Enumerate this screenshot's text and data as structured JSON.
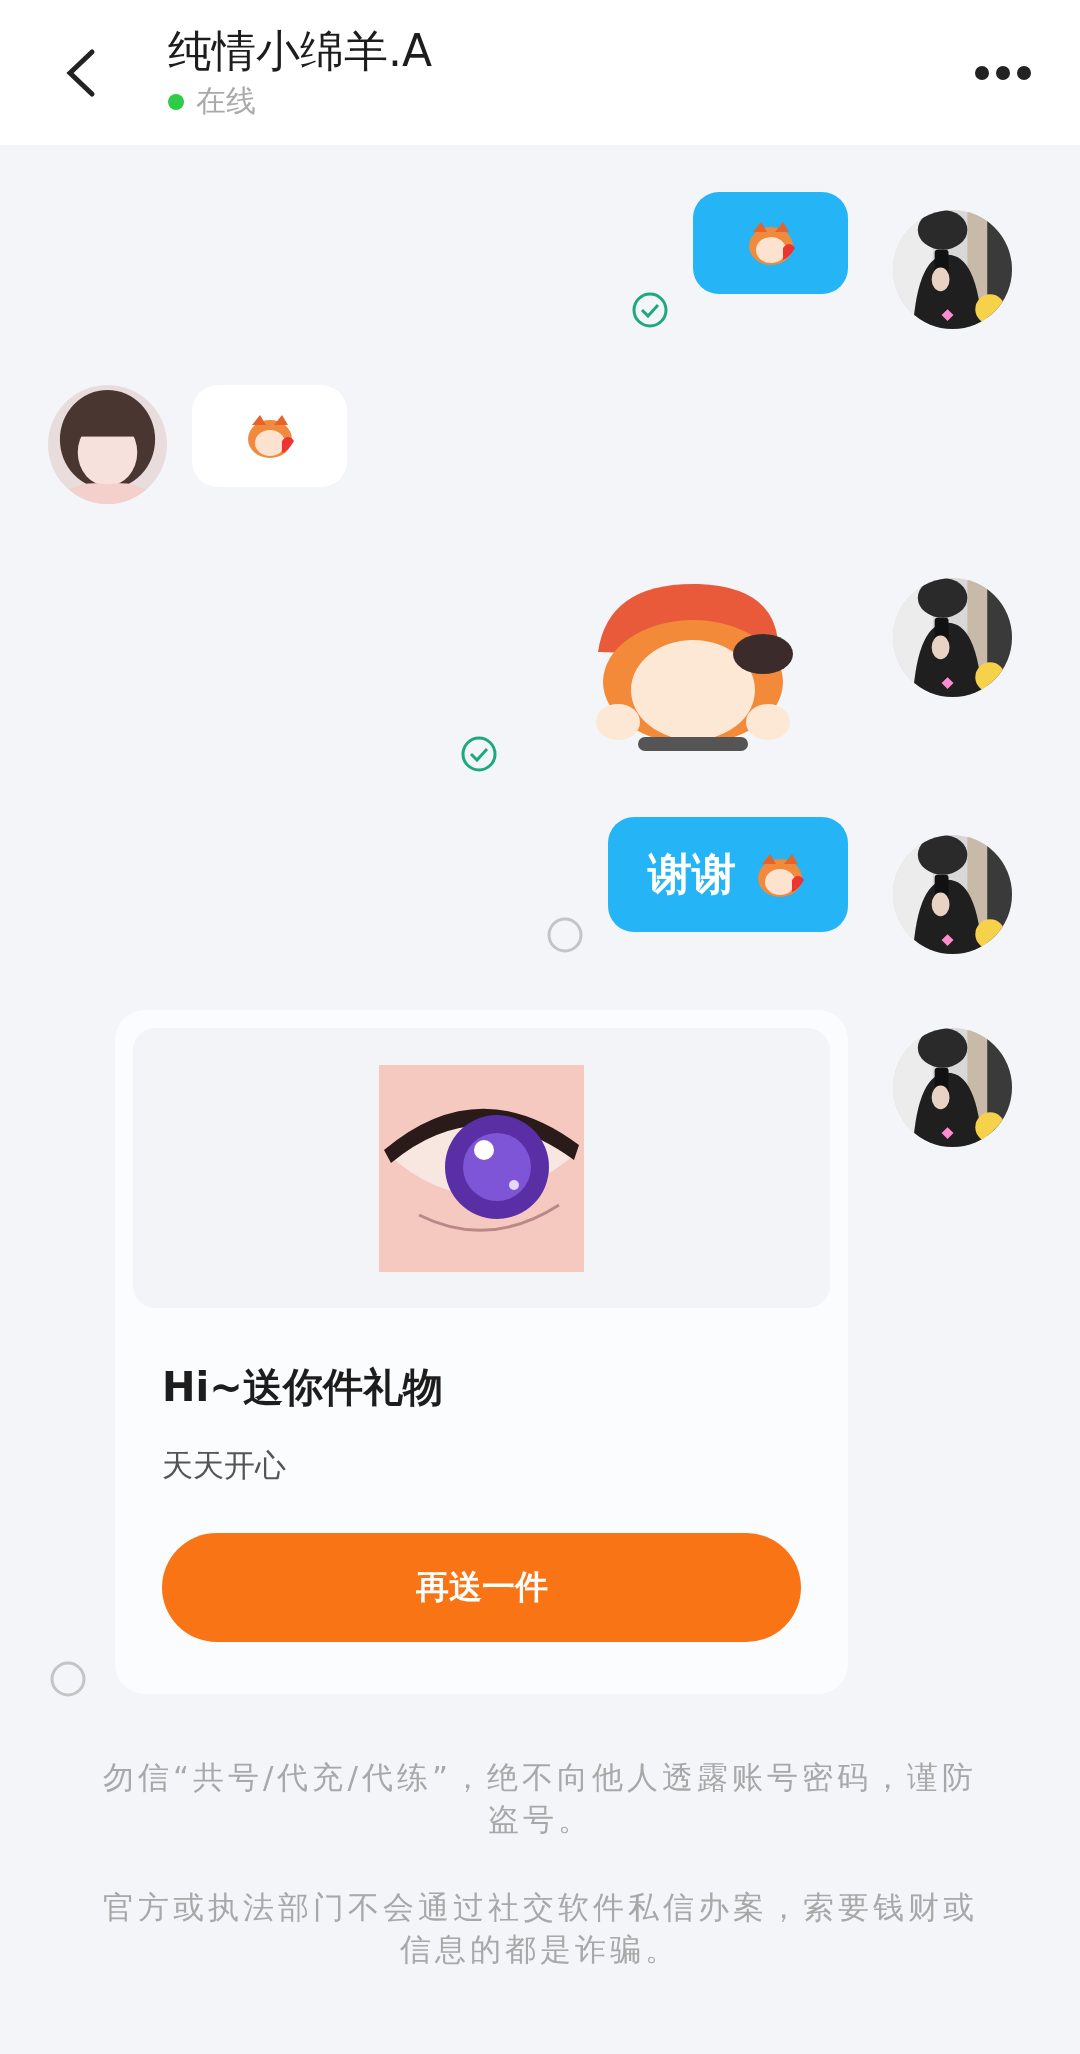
{
  "header": {
    "title": "纯情小绵羊.A",
    "status": "在线",
    "online": true
  },
  "messages": [
    {
      "outgoing": true,
      "kind": "sticker",
      "read": true
    },
    {
      "outgoing": false,
      "kind": "sticker"
    },
    {
      "outgoing": true,
      "kind": "big_sticker",
      "read": true
    },
    {
      "outgoing": true,
      "kind": "text",
      "text": "谢谢",
      "read": false
    },
    {
      "outgoing": true,
      "kind": "gift",
      "title": "Hi~送你件礼物",
      "note": "天天开心",
      "button": "再送一件",
      "read": false
    }
  ],
  "notices": [
    "勿信“共号/代充/代练”，绝不向他人透露账号密码，谨防盗号。",
    "官方或执法部门不会通过社交软件私信办案，索要钱财或信息的都是诈骗。"
  ]
}
